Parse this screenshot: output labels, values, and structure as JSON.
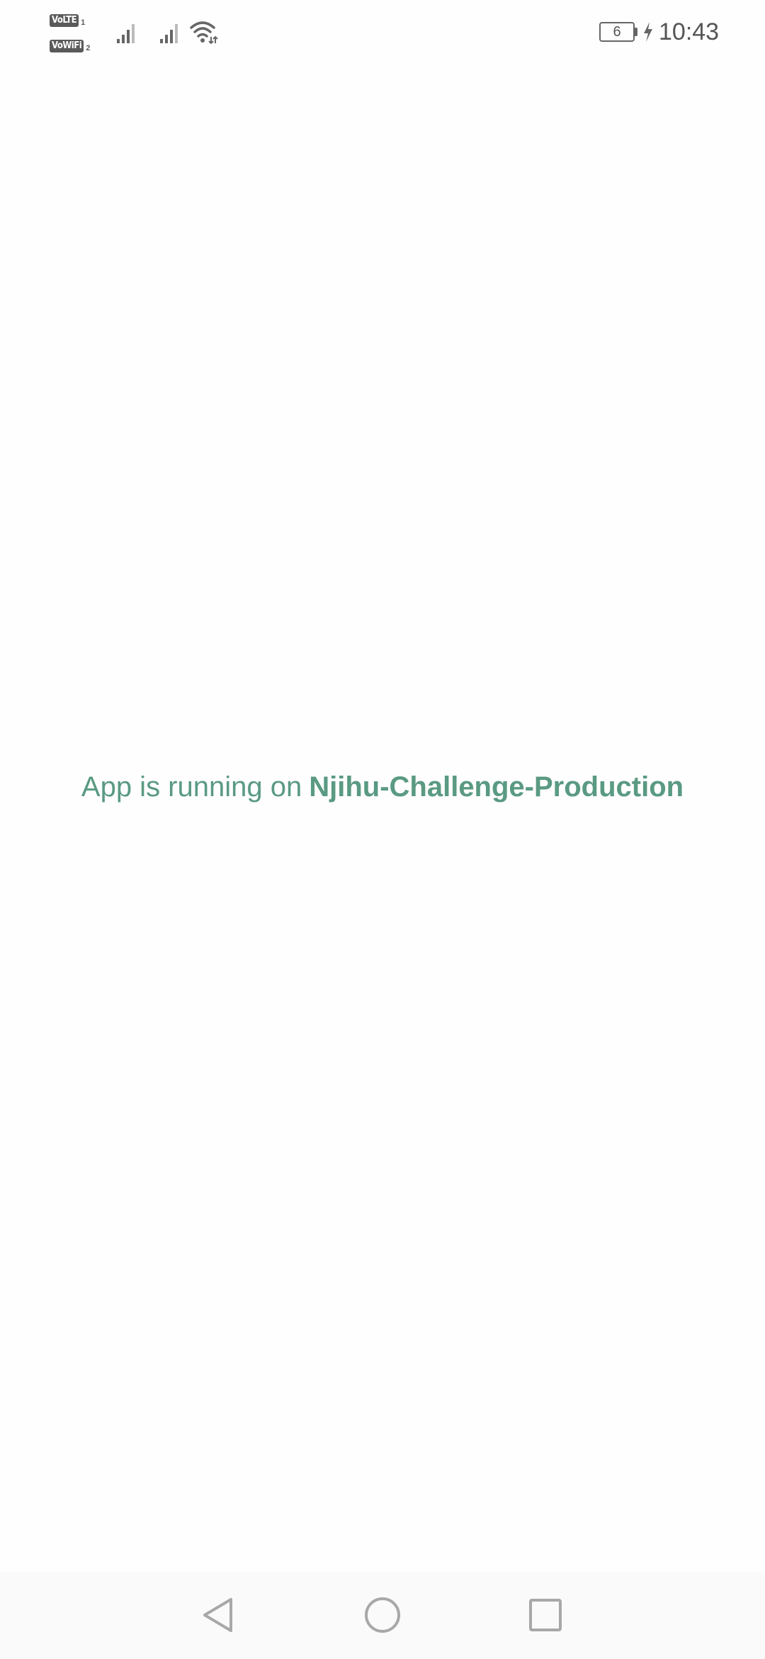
{
  "status_bar": {
    "network_badges": [
      {
        "label": "VoLTE",
        "slot": "1"
      },
      {
        "label": "VoWiFi",
        "slot": "2"
      }
    ],
    "battery_level": "6",
    "time": "10:43",
    "icons": [
      "signal-icon",
      "signal-icon",
      "wifi-icon",
      "battery-icon",
      "charging-bolt-icon"
    ],
    "icon_color": "#666666"
  },
  "main": {
    "message_prefix": "App is running on",
    "environment_name": "Njihu-Challenge-Production",
    "text_color": "#5a9a82"
  },
  "nav_bar": {
    "buttons": [
      "back-icon",
      "home-icon",
      "recents-icon"
    ],
    "icon_color": "#a8a8a8",
    "background": "#fafafa"
  }
}
